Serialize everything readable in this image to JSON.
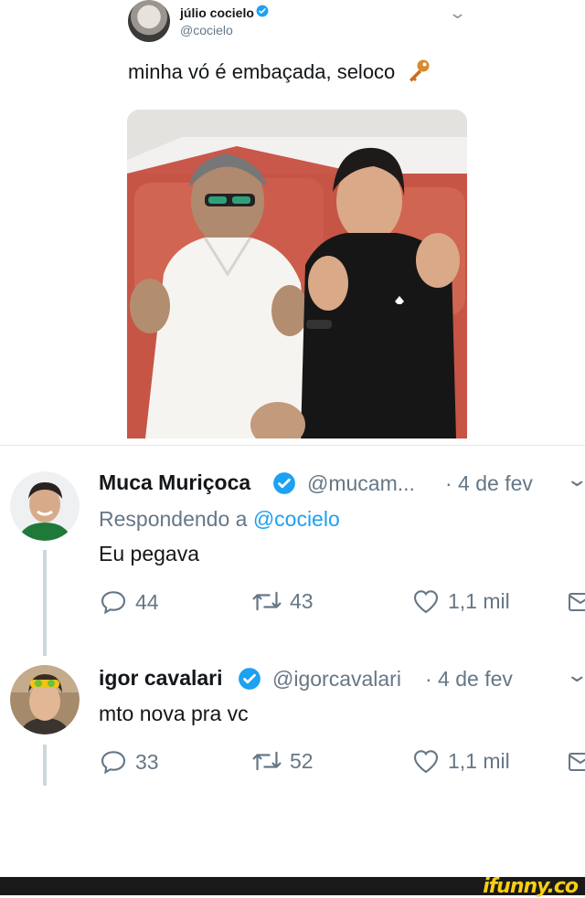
{
  "main_tweet": {
    "display_name": "júlio cocielo",
    "handle": "@cocielo",
    "text": "minha vó é embaçada, seloco"
  },
  "replies": [
    {
      "display_name": "Muca Muriçoca",
      "handle": "@mucam...",
      "date": "· 4 de fev",
      "replying_prefix": "Respondendo a",
      "replying_to": "@cocielo",
      "text": "Eu pegava",
      "reply_count": "44",
      "retweet_count": "43",
      "like_count": "1,1 mil"
    },
    {
      "display_name": "igor cavalari",
      "handle": "@igorcavalari",
      "date": "· 4 de fev",
      "text": "mto nova pra vc",
      "reply_count": "33",
      "retweet_count": "52",
      "like_count": "1,1 mil"
    }
  ],
  "watermark": "ifunny.co",
  "colors": {
    "verified": "#1da1f2",
    "meta_text": "#657786",
    "watermark": "#f9ce11"
  }
}
